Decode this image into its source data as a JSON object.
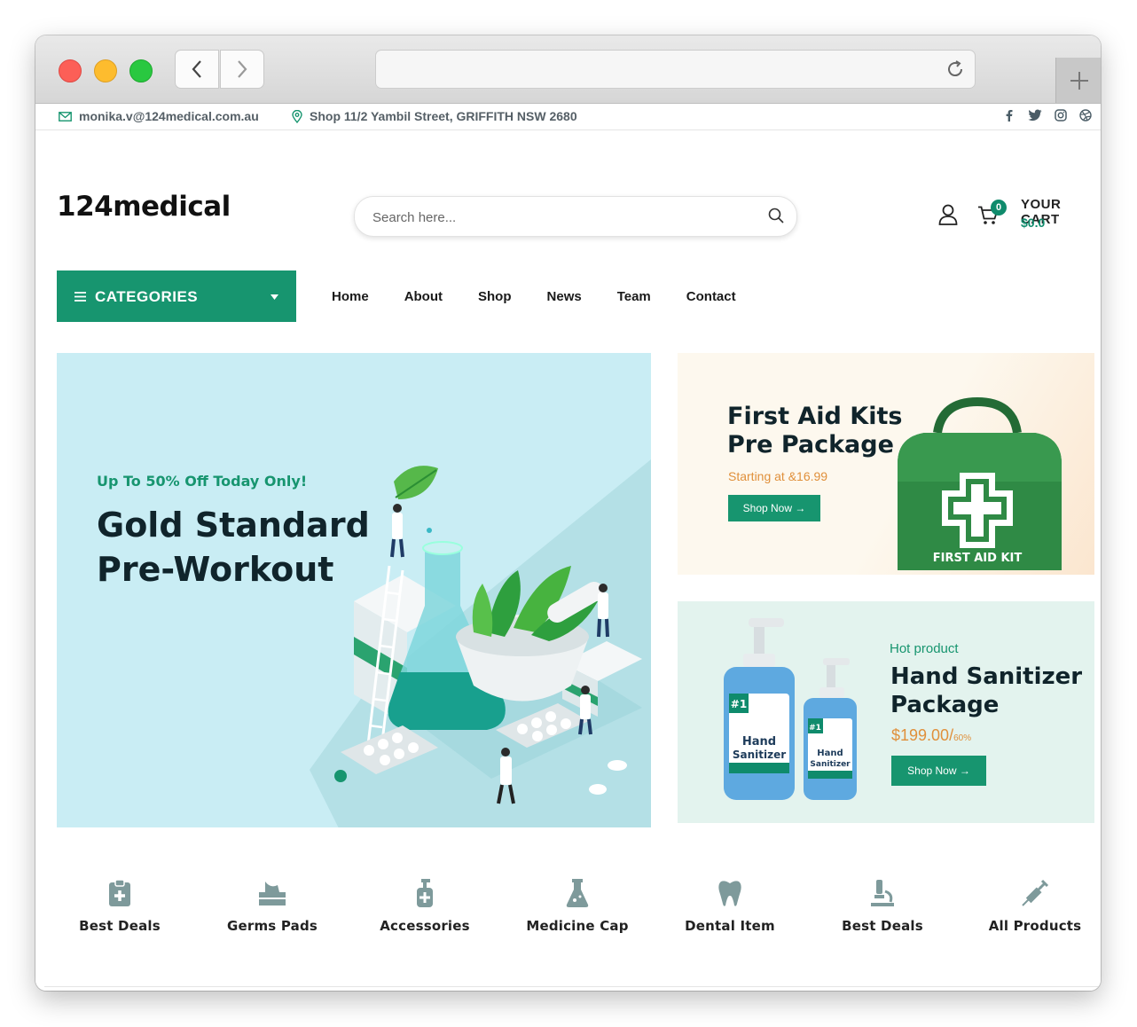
{
  "topbar": {
    "email": "monika.v@124medical.com.au",
    "address": "Shop 11/2 Yambil Street, GRIFFITH NSW 2680",
    "socials": [
      "facebook-icon",
      "twitter-icon",
      "instagram-icon",
      "dribbble-icon"
    ]
  },
  "header": {
    "logo": "124medical",
    "search_placeholder": "Search here...",
    "cart_count": "0",
    "cart_title": "YOUR CART",
    "cart_total": "$0.0"
  },
  "nav": {
    "categories_label": "CATEGORIES",
    "links": [
      "Home",
      "About",
      "Shop",
      "News",
      "Team",
      "Contact"
    ]
  },
  "hero": {
    "subtitle": "Up To 50% Off Today Only!",
    "title_line1": "Gold Standard",
    "title_line2": "Pre-Workout"
  },
  "banner_first_aid": {
    "title_line1": "First Aid Kits",
    "title_line2": "Pre Package",
    "price_text": "Starting at &16.99",
    "button": "Shop Now →",
    "bag_label": "FIRST AID KIT"
  },
  "banner_sanitizer": {
    "tag": "Hot product",
    "title_line1": "Hand Sanitizer",
    "title_line2": "Package",
    "price": "$199.00/",
    "discount": "60%",
    "button": "Shop Now →"
  },
  "categories_row": [
    {
      "label": "Best Deals",
      "icon": "clipboard-plus-icon"
    },
    {
      "label": "Germs Pads",
      "icon": "tissue-box-icon"
    },
    {
      "label": "Accessories",
      "icon": "sanitizer-bottle-icon"
    },
    {
      "label": "Medicine Cap",
      "icon": "flask-icon"
    },
    {
      "label": "Dental Item",
      "icon": "tooth-icon"
    },
    {
      "label": "Best Deals",
      "icon": "microscope-icon"
    },
    {
      "label": "All Products",
      "icon": "syringe-icon"
    }
  ],
  "colors": {
    "brand_green": "#17956f",
    "accent_orange": "#e0903b",
    "hero_bg": "#c9edf4",
    "icon_gray": "#7e9a9b"
  }
}
